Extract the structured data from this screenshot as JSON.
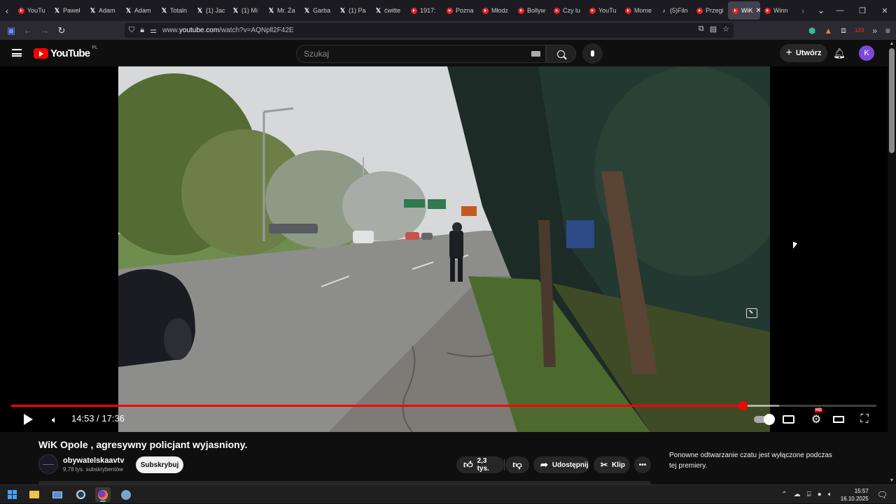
{
  "browser": {
    "tabs": [
      {
        "label": "YouTu",
        "icon": "youtube-icon",
        "kind": "yt"
      },
      {
        "label": "Paweł",
        "icon": "x-icon",
        "kind": "x"
      },
      {
        "label": "Adam",
        "icon": "x-icon",
        "kind": "x"
      },
      {
        "label": "Adam",
        "icon": "x-icon",
        "kind": "x"
      },
      {
        "label": "Totaln",
        "icon": "x-icon",
        "kind": "x"
      },
      {
        "label": "(1) Jac",
        "icon": "x-icon",
        "kind": "x"
      },
      {
        "label": "(1) Mi",
        "icon": "x-icon",
        "kind": "x"
      },
      {
        "label": "Mr. Ża",
        "icon": "x-icon",
        "kind": "x"
      },
      {
        "label": "Garba",
        "icon": "x-icon",
        "kind": "x"
      },
      {
        "label": "(1) Pa",
        "icon": "x-icon",
        "kind": "x"
      },
      {
        "label": "ćwitte",
        "icon": "x-icon",
        "kind": "x"
      },
      {
        "label": "1917:",
        "icon": "youtube-icon",
        "kind": "yt"
      },
      {
        "label": "Pozna",
        "icon": "youtube-icon",
        "kind": "yt"
      },
      {
        "label": "Młodz",
        "icon": "youtube-icon",
        "kind": "yt"
      },
      {
        "label": "Bollyw",
        "icon": "youtube-icon",
        "kind": "yt"
      },
      {
        "label": "Czy lu",
        "icon": "youtube-icon",
        "kind": "yt"
      },
      {
        "label": "YouTu",
        "icon": "youtube-icon",
        "kind": "yt"
      },
      {
        "label": "Mome",
        "icon": "youtube-icon",
        "kind": "yt"
      },
      {
        "label": "(5)Filn",
        "icon": "tiktok-icon",
        "kind": "tk"
      },
      {
        "label": "Przegi",
        "icon": "youtube-icon",
        "kind": "yt"
      },
      {
        "label": "WiK",
        "icon": "youtube-icon",
        "kind": "yt",
        "active": true
      },
      {
        "label": "Winn",
        "icon": "youtube-icon",
        "kind": "yt"
      }
    ],
    "url_prefix": "www.",
    "url_host": "youtube.com",
    "url_path": "/watch?v=AQNpll2F42E",
    "ext_badge": "133"
  },
  "youtube": {
    "logo_text": "YouTube",
    "country_code": "PL",
    "search_placeholder": "Szukaj",
    "create_label": "Utwórz",
    "avatar_letter": "K"
  },
  "player": {
    "current_time": "14:53",
    "duration": "17:36",
    "time_display": "14:53 / 17:36",
    "played_fraction": 0.8455,
    "loaded_fraction": 0.8875,
    "hd_badge": "HD"
  },
  "video": {
    "title": "WiK Opole , agresywny policjant wyjasniony.",
    "channel_name": "obywatelskaavtv",
    "subscribers": "9,78 tys. subskrybentów",
    "subscribe_label": "Subskrybuj",
    "likes": "2,3 tys.",
    "share_label": "Udostępnij",
    "clip_label": "Klip",
    "chat_note": "Ponowne odtwarzanie czatu jest wyłączone podczas tej premiery."
  },
  "taskbar": {
    "time": "15:57",
    "date": "16.10.2025"
  },
  "colors": {
    "accent_red": "#ff0000",
    "background": "#0f0f0f",
    "pill": "#272727"
  }
}
